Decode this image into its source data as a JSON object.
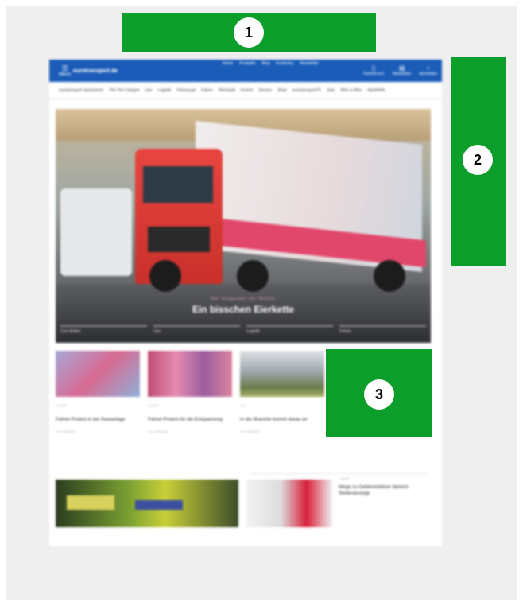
{
  "markers": [
    "1",
    "2",
    "3"
  ],
  "site": {
    "menu_label": "Menü",
    "logo": "eurotransport.de",
    "top_links": [
      "Home",
      "Produkte",
      "Blog",
      "Kostenlos",
      "Newsletter"
    ],
    "right_items": [
      {
        "icon": "cart-icon",
        "label": "Themen A-Z"
      },
      {
        "icon": "newsletter-icon",
        "label": "Newsletter"
      },
      {
        "icon": "user-icon",
        "label": "Anmelden"
      }
    ],
    "nav_items": [
      "eurotransport abonnieren",
      "The Tire Cologne",
      "Lkw",
      "Logistik",
      "Fahrzeuge",
      "Fahrer",
      "Werkstatt",
      "Events",
      "Service",
      "Shop",
      "eurotransportTV",
      "Jobs",
      "Who is Who",
      "Abo/Hefte"
    ],
    "hero": {
      "kicker": "Der Hingucker der Woche",
      "title": "Ein bisschen Eierkette",
      "tabs": [
        "Zum Artikel",
        "Lkw",
        "Logistik",
        "Fahrer"
      ]
    },
    "cards": [
      {
        "kicker": "Logistik",
        "title": "Fahrer-Protest in der Rastanlage",
        "meta": "Vor 2 Stunden"
      },
      {
        "kicker": "Logistik",
        "title": "Fahrer-Protest für die Entspannung",
        "meta": "Vor 3 Stunden"
      },
      {
        "kicker": "Lkw",
        "title": "In der Branche kommt etwas an",
        "meta": "Vor 4 Stunden"
      }
    ],
    "bottom": {
      "kicker": "Logistik",
      "title": "Wege zu Gefahrenfahrer fahrerin Stellenanzeige"
    }
  },
  "colors": {
    "annotation_green": "#0b9e2a",
    "site_blue": "#1b5cb8"
  }
}
